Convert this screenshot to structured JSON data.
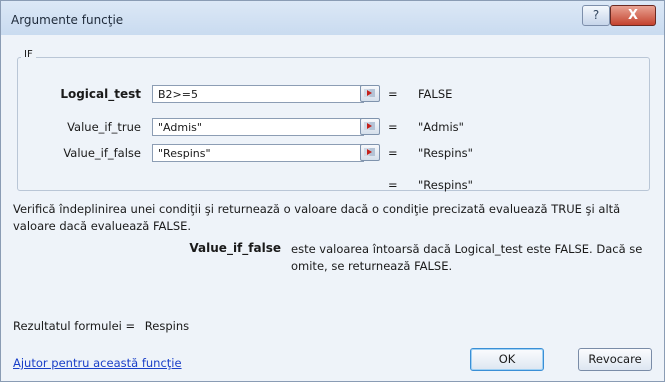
{
  "dialog": {
    "title": "Argumente funcţie",
    "help_btn": "?",
    "close_btn": "X"
  },
  "function_group": {
    "name": "IF",
    "args": [
      {
        "label": "Logical_test",
        "value": "B2>=5",
        "eq": "=",
        "result": "FALSE"
      },
      {
        "label": "Value_if_true",
        "value": "\"Admis\"",
        "eq": "=",
        "result": "\"Admis\""
      },
      {
        "label": "Value_if_false",
        "value": "\"Respins\"",
        "eq": "=",
        "result": "\"Respins\""
      }
    ],
    "overall_eq": "=",
    "overall_result": "\"Respins\""
  },
  "description": "Verifică îndeplinirea unei condiţii şi returnează o valoare dacă o condiţie precizată evaluează TRUE şi altă valoare dacă evaluează FALSE.",
  "arg_help": {
    "name": "Value_if_false",
    "text": "este valoarea întoarsă dacă Logical_test este FALSE. Dacă se omite, se returnează FALSE."
  },
  "formula_result": {
    "label": "Rezultatul formulei =",
    "value": "Respins"
  },
  "help_link": "Ajutor pentru această funcţie",
  "buttons": {
    "ok": "OK",
    "cancel": "Revocare"
  }
}
